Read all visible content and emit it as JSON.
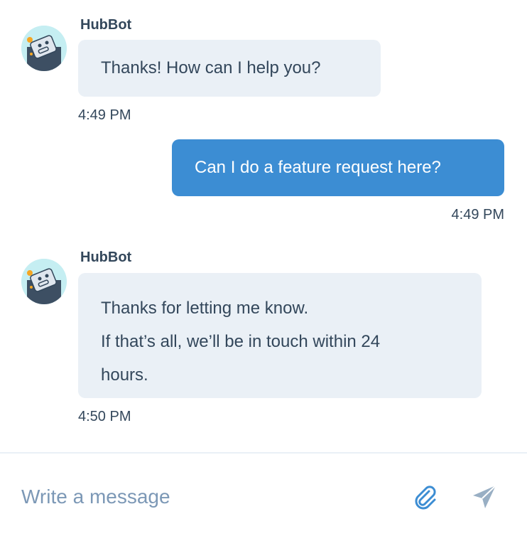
{
  "colors": {
    "bot_bubble": "#eaf0f6",
    "user_bubble": "#3c8dd3",
    "text": "#33475b",
    "placeholder": "#7c98b6",
    "attach_icon": "#3c8dd3",
    "send_icon": "#99afc4"
  },
  "messages": [
    {
      "sender": "HubBot",
      "lines": [
        "Thanks! How can I help you?"
      ],
      "time": "4:49 PM"
    },
    {
      "lines": [
        "Can I do a feature request here?"
      ],
      "time": "4:49 PM"
    },
    {
      "sender": "HubBot",
      "lines": [
        "Thanks for letting me know.",
        "If that’s all, we’ll be in touch within 24",
        "hours."
      ],
      "time": "4:50 PM"
    }
  ],
  "composer": {
    "placeholder": "Write a message",
    "attach_icon": "paperclip-icon",
    "send_icon": "send-icon"
  }
}
